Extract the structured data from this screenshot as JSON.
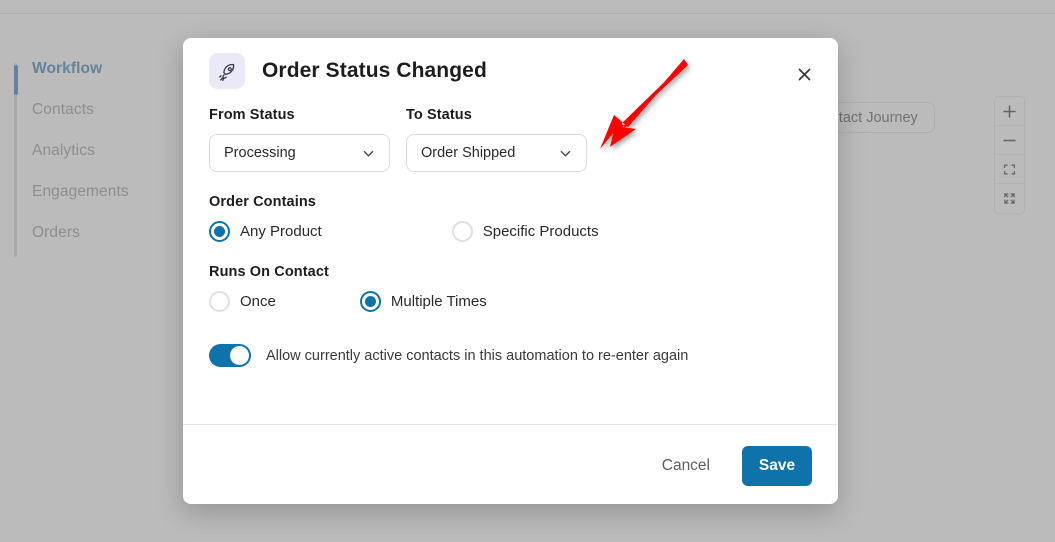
{
  "sidebar": {
    "items": [
      {
        "label": "Workflow",
        "active": true
      },
      {
        "label": "Contacts",
        "active": false
      },
      {
        "label": "Analytics",
        "active": false
      },
      {
        "label": "Engagements",
        "active": false
      },
      {
        "label": "Orders",
        "active": false
      }
    ]
  },
  "canvas": {
    "view_journey_label": "View Contact Journey",
    "zoom_controls": [
      {
        "icon": "plus-icon",
        "name": "zoom-in-button"
      },
      {
        "icon": "minus-icon",
        "name": "zoom-out-button"
      },
      {
        "icon": "fit-view-icon",
        "name": "fit-view-button"
      },
      {
        "icon": "expand-icon",
        "name": "expand-button"
      }
    ]
  },
  "modal": {
    "icon": "rocket-icon",
    "title": "Order Status Changed",
    "close_icon": "close-icon",
    "from_status": {
      "label": "From Status",
      "value": "Processing"
    },
    "to_status": {
      "label": "To Status",
      "value": "Order Shipped"
    },
    "order_contains": {
      "label": "Order Contains",
      "options": [
        {
          "label": "Any Product",
          "selected": true
        },
        {
          "label": "Specific Products",
          "selected": false
        }
      ]
    },
    "runs_on_contact": {
      "label": "Runs On Contact",
      "options": [
        {
          "label": "Once",
          "selected": false
        },
        {
          "label": "Multiple Times",
          "selected": true
        }
      ]
    },
    "reenter_toggle": {
      "label": "Allow currently active contacts in this automation to re-enter again",
      "on": true
    },
    "footer": {
      "cancel_label": "Cancel",
      "save_label": "Save"
    }
  },
  "annotation": {
    "type": "arrow",
    "color": "#fe0000",
    "points_to": "to-status-dropdown"
  },
  "colors": {
    "accent": "#0e72ab",
    "sidebar_active": "#136ea5",
    "icon_badge_bg": "#e9e9f8",
    "overlay": "#919191",
    "annotation_red": "#fe0000"
  }
}
